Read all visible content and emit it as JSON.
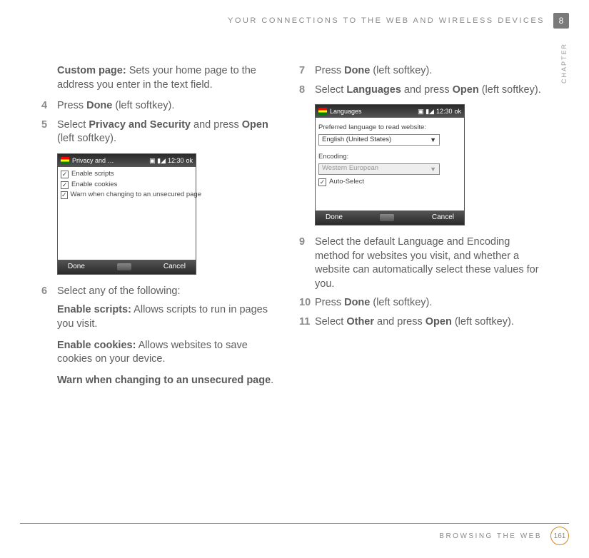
{
  "header": {
    "title": "YOUR CONNECTIONS TO THE WEB AND WIRELESS DEVICES",
    "chapter_num": "8",
    "chapter_label": "CHAPTER"
  },
  "left": {
    "intro_bold": "Custom page:",
    "intro_rest": " Sets your home page to the address you enter in the text field.",
    "s4_num": "4",
    "s4_a": "Press ",
    "s4_b": "Done",
    "s4_c": " (left softkey).",
    "s5_num": "5",
    "s5_a": "Select ",
    "s5_b": "Privacy and Security",
    "s5_c": " and press ",
    "s5_d": "Open",
    "s5_e": " (left softkey).",
    "shot1": {
      "title": "Privacy and …",
      "time": "12:30",
      "chk1": "Enable scripts",
      "chk2": "Enable cookies",
      "chk3": "Warn when changing to an unsecured page",
      "bl": "Done",
      "br": "Cancel"
    },
    "s6_num": "6",
    "s6": "Select any of the following:",
    "o1b": "Enable scripts:",
    "o1r": " Allows scripts to run in pages you visit.",
    "o2b": "Enable cookies:",
    "o2r": " Allows websites to save cookies on your device.",
    "o3b": "Warn when changing to an unsecured page",
    "o3r": "."
  },
  "right": {
    "s7_num": "7",
    "s7_a": "Press ",
    "s7_b": "Done",
    "s7_c": " (left softkey).",
    "s8_num": "8",
    "s8_a": "Select ",
    "s8_b": "Languages",
    "s8_c": " and press ",
    "s8_d": "Open",
    "s8_e": " (left softkey).",
    "shot2": {
      "title": "Languages",
      "time": "12:30",
      "lbl1": "Preferred language to read website:",
      "dd1": "English (United States)",
      "lbl2": "Encoding:",
      "dd2": "Western European",
      "auto": "Auto-Select",
      "bl": "Done",
      "br": "Cancel"
    },
    "s9_num": "9",
    "s9": "Select the default Language and Encoding method for websites you visit, and whether a website can automatically select these values for you.",
    "s10_num": "10",
    "s10_a": "Press ",
    "s10_b": "Done",
    "s10_c": " (left softkey).",
    "s11_num": "11",
    "s11_a": "Select ",
    "s11_b": "Other",
    "s11_c": " and press ",
    "s11_d": "Open",
    "s11_e": " (left softkey)."
  },
  "footer": {
    "text": "BROWSING THE WEB",
    "page": "161"
  }
}
